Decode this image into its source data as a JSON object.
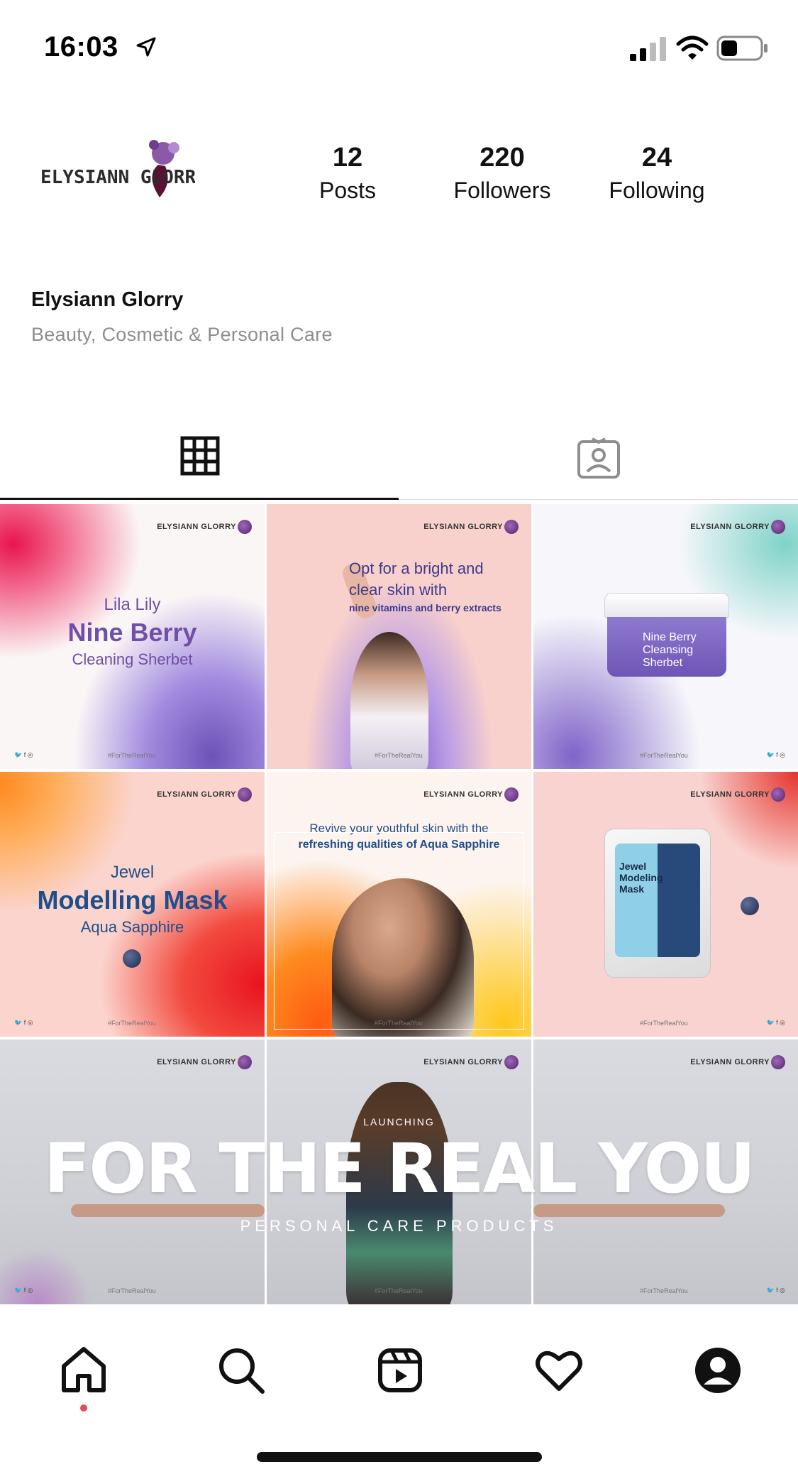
{
  "status_bar": {
    "time": "16:03"
  },
  "profile": {
    "logo_text": "ELYSIANN GLORRY",
    "name": "Elysiann Glorry",
    "category": "Beauty, Cosmetic & Personal Care"
  },
  "stats": {
    "posts": {
      "value": "12",
      "label": "Posts"
    },
    "followers": {
      "value": "220",
      "label": "Followers"
    },
    "following": {
      "value": "24",
      "label": "Following"
    }
  },
  "tabs": [
    {
      "name": "grid",
      "active": true
    },
    {
      "name": "tagged",
      "active": false
    }
  ],
  "posts": [
    {
      "brand": "ELYSIANN GLORRY",
      "lines": [
        "Lila Lily",
        "Nine Berry",
        "Cleaning Sherbet"
      ],
      "hashtag": "#ForTheRealYou",
      "social": "🐦 f ◎"
    },
    {
      "brand": "ELYSIANN GLORRY",
      "lines": [
        "Opt for a bright and",
        "clear skin with",
        "nine vitamins and berry extracts"
      ],
      "hashtag": "#ForTheRealYou"
    },
    {
      "brand": "ELYSIANN GLORRY",
      "product": [
        "Nine Berry",
        "Cleansing Sherbet"
      ],
      "hashtag": "#ForTheRealYou",
      "social": "🐦 f ◎"
    },
    {
      "brand": "ELYSIANN GLORRY",
      "lines": [
        "Jewel",
        "Modelling Mask",
        "Aqua Sapphire"
      ],
      "hashtag": "#ForTheRealYou",
      "social": "🐦 f ◎"
    },
    {
      "brand": "ELYSIANN GLORRY",
      "lines": [
        "Revive your youthful skin with the",
        "refreshing qualities of Aqua Sapphire"
      ],
      "hashtag": "#ForTheRealYou"
    },
    {
      "brand": "ELYSIANN GLORRY",
      "product": [
        "Jewel",
        "Modeling",
        "Mask"
      ],
      "hashtag": "#ForTheRealYou",
      "social": "🐦 f ◎"
    },
    {
      "brand": "ELYSIANN GLORRY",
      "hashtag": "#ForTheRealYou",
      "social": "🐦 f ◎"
    },
    {
      "brand": "ELYSIANN GLORRY",
      "hashtag": "#ForTheRealYou"
    },
    {
      "brand": "ELYSIANN GLORRY",
      "hashtag": "#ForTheRealYou",
      "social": "🐦 f ◎"
    }
  ],
  "banner": {
    "launching": "LAUNCHING",
    "title": "FOR THE REAL YOU",
    "subtitle": "PERSONAL CARE PRODUCTS"
  },
  "bottom_nav": [
    "home-icon",
    "search-icon",
    "reels-icon",
    "heart-icon",
    "profile-icon"
  ],
  "colors": {
    "accent_dot": "#ed4956",
    "purple": "#6f4fa8",
    "navy": "#1f4f8a"
  }
}
